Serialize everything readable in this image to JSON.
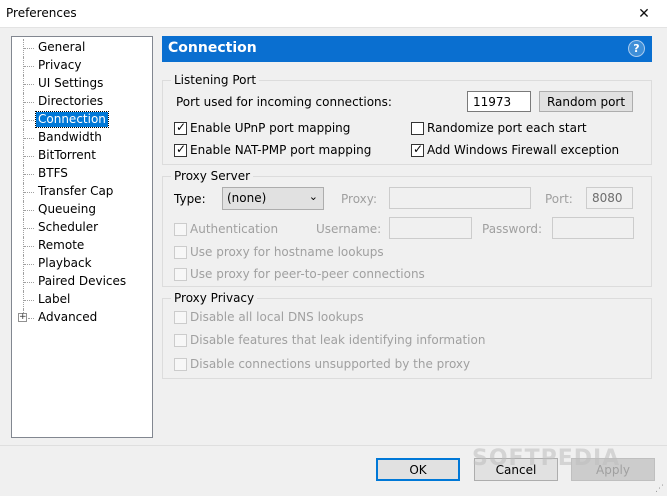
{
  "window": {
    "title": "Preferences",
    "close_glyph": "✕"
  },
  "tree": {
    "items": [
      {
        "label": "General",
        "selected": false
      },
      {
        "label": "Privacy",
        "selected": false
      },
      {
        "label": "UI Settings",
        "selected": false
      },
      {
        "label": "Directories",
        "selected": false
      },
      {
        "label": "Connection",
        "selected": true
      },
      {
        "label": "Bandwidth",
        "selected": false
      },
      {
        "label": "BitTorrent",
        "selected": false
      },
      {
        "label": "BTFS",
        "selected": false
      },
      {
        "label": "Transfer Cap",
        "selected": false
      },
      {
        "label": "Queueing",
        "selected": false
      },
      {
        "label": "Scheduler",
        "selected": false
      },
      {
        "label": "Remote",
        "selected": false
      },
      {
        "label": "Playback",
        "selected": false
      },
      {
        "label": "Paired Devices",
        "selected": false
      },
      {
        "label": "Label",
        "selected": false
      },
      {
        "label": "Advanced",
        "selected": false,
        "expander": "+"
      }
    ]
  },
  "panel": {
    "title": "Connection",
    "help_glyph": "?"
  },
  "listening": {
    "legend": "Listening Port",
    "port_label": "Port used for incoming connections:",
    "port_value": "11973",
    "random_button": "Random port",
    "upnp": {
      "label": "Enable UPnP port mapping",
      "checked": true
    },
    "randomize": {
      "label": "Randomize port each start",
      "checked": false
    },
    "natpmp": {
      "label": "Enable NAT-PMP port mapping",
      "checked": true
    },
    "firewall": {
      "label": "Add Windows Firewall exception",
      "checked": true
    }
  },
  "proxy": {
    "legend": "Proxy Server",
    "type_label": "Type:",
    "type_value": "(none)",
    "proxy_label": "Proxy:",
    "proxy_value": "",
    "port_label": "Port:",
    "port_value": "8080",
    "auth": {
      "label": "Authentication",
      "checked": false
    },
    "username_label": "Username:",
    "password_label": "Password:",
    "hostname": {
      "label": "Use proxy for hostname lookups",
      "checked": false
    },
    "p2p": {
      "label": "Use proxy for peer-to-peer connections",
      "checked": false
    }
  },
  "privacy": {
    "legend": "Proxy Privacy",
    "dns": {
      "label": "Disable all local DNS lookups",
      "checked": false
    },
    "leak": {
      "label": "Disable features that leak identifying information",
      "checked": false
    },
    "unsupported": {
      "label": "Disable connections unsupported by the proxy",
      "checked": false
    }
  },
  "buttons": {
    "ok": "OK",
    "cancel": "Cancel",
    "apply": "Apply"
  },
  "watermark": "SOFTPEDIA",
  "colors": {
    "header_bg": "#0a6fd0",
    "selection": "#0078d7"
  }
}
